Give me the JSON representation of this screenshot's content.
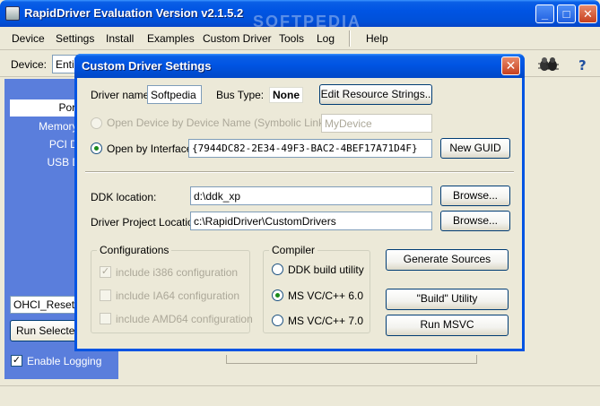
{
  "main": {
    "title": "RapidDriver Evaluation Version v2.1.5.2",
    "watermark": "SOFTPEDIA",
    "minimize_glyph": "_",
    "maximize_glyph": "□",
    "close_glyph": "✕",
    "menu": [
      "Device",
      "Settings",
      "Install",
      "Examples",
      "Custom Driver",
      "Tools",
      "Log",
      "Help"
    ],
    "toolbar": {
      "device_label": "Device:",
      "device_value": "Enti"
    },
    "toolbar_icons": [
      "bug-icon",
      "help-icon"
    ],
    "left_nav": [
      "Port I/",
      "Memory-map",
      "PCI Devi",
      "USB Devi"
    ],
    "combo_value": "OHCI_Reset",
    "run_button": "Run Selected",
    "enable_logging": {
      "label": "Enable Logging",
      "checked": true
    }
  },
  "dialog": {
    "title": "Custom Driver Settings",
    "close_glyph": "✕",
    "driver_name_label": "Driver name:",
    "driver_name_value": "Softpedia",
    "bus_type_label": "Bus Type:",
    "bus_type_value": "None",
    "edit_resource_button": "Edit Resource Strings..",
    "open_symbolic_label": "Open Device by Device Name (Symbolic Link):",
    "symbolic_value": "MyDevice",
    "open_interface_label": "Open by Interface:",
    "interface_value": "{7944DC82-2E34-49F3-BAC2-4BEF17A71D4F}",
    "new_guid_button": "New GUID",
    "ddk_label": "DDK location:",
    "ddk_value": "d:\\ddk_xp",
    "project_label": "Driver Project Location:",
    "project_value": "c:\\RapidDriver\\CustomDrivers",
    "browse_button": "Browse...",
    "configurations": {
      "title": "Configurations",
      "items": [
        {
          "label": "include i386 configuration",
          "checked": true
        },
        {
          "label": "include IA64 configuration",
          "checked": false
        },
        {
          "label": "include  AMD64 configuration",
          "checked": false
        }
      ]
    },
    "compiler": {
      "title": "Compiler",
      "options": [
        {
          "label": "DDK build utility",
          "selected": false
        },
        {
          "label": "MS VC/C++ 6.0",
          "selected": true
        },
        {
          "label": "MS VC/C++ 7.0",
          "selected": false
        }
      ]
    },
    "generate_button": "Generate Sources",
    "build_button": "\"Build\" Utility",
    "run_msvc_button": "Run MSVC"
  }
}
